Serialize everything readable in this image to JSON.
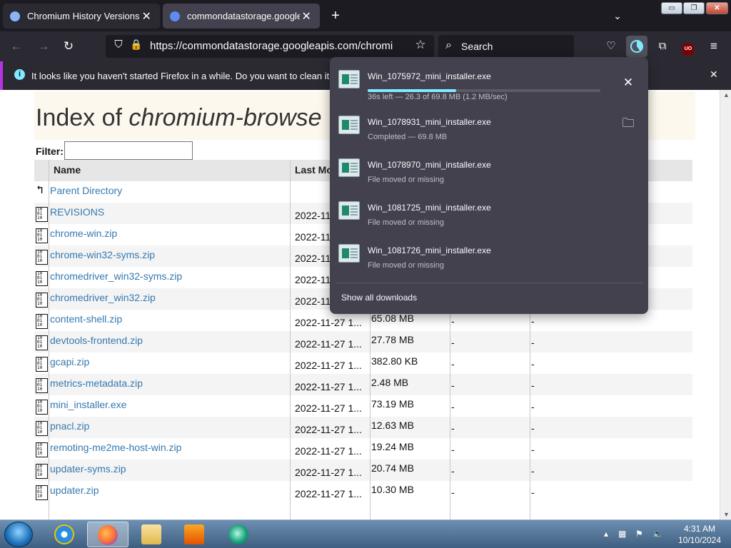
{
  "tabs": [
    {
      "title": "Chromium History Versions Do",
      "close": "✕"
    },
    {
      "title": "commondatastorage.googleapis",
      "close": "✕"
    }
  ],
  "new_tab": "+",
  "tab_list": "⌄",
  "window_controls": {
    "minimize": "▭",
    "maximize": "❐",
    "close": "✕"
  },
  "nav": {
    "back": "←",
    "forward": "→",
    "reload": "↻"
  },
  "url_bar": {
    "url": "https://commondatastorage.googleapis.com/chromium-bro"
  },
  "search_bar": {
    "placeholder": "Search"
  },
  "notification": {
    "message": "It looks like you haven't started Firefox in a while. Do you want to clean it up for",
    "close": "✕"
  },
  "page": {
    "title_prefix": "Index of ",
    "title_italic": "chromium-browse",
    "filter_label": "Filter:",
    "columns": [
      "Name",
      "Last Mo"
    ],
    "parent_directory": "Parent Directory",
    "rows": [
      {
        "name": "REVISIONS",
        "date": "2022-11",
        "size": "",
        "c1": "",
        "c2": ""
      },
      {
        "name": "chrome-win.zip",
        "date": "2022-11",
        "size": "",
        "c1": "",
        "c2": ""
      },
      {
        "name": "chrome-win32-syms.zip",
        "date": "2022-11",
        "size": "",
        "c1": "",
        "c2": ""
      },
      {
        "name": "chromedriver_win32-syms.zip",
        "date": "2022-11",
        "size": "",
        "c1": "",
        "c2": ""
      },
      {
        "name": "chromedriver_win32.zip",
        "date": "2022-11",
        "size": "",
        "c1": "",
        "c2": ""
      },
      {
        "name": "content-shell.zip",
        "date": "2022-11-27 1...",
        "size": "65.08 MB",
        "c1": "-",
        "c2": "-"
      },
      {
        "name": "devtools-frontend.zip",
        "date": "2022-11-27 1...",
        "size": "27.78 MB",
        "c1": "-",
        "c2": "-"
      },
      {
        "name": "gcapi.zip",
        "date": "2022-11-27 1...",
        "size": "382.80 KB",
        "c1": "-",
        "c2": "-"
      },
      {
        "name": "metrics-metadata.zip",
        "date": "2022-11-27 1...",
        "size": "2.48 MB",
        "c1": "-",
        "c2": "-"
      },
      {
        "name": "mini_installer.exe",
        "date": "2022-11-27 1...",
        "size": "73.19 MB",
        "c1": "-",
        "c2": "-"
      },
      {
        "name": "pnacl.zip",
        "date": "2022-11-27 1...",
        "size": "12.63 MB",
        "c1": "-",
        "c2": "-"
      },
      {
        "name": "remoting-me2me-host-win.zip",
        "date": "2022-11-27 1...",
        "size": "19.24 MB",
        "c1": "-",
        "c2": "-"
      },
      {
        "name": "updater-syms.zip",
        "date": "2022-11-27 1...",
        "size": "20.74 MB",
        "c1": "-",
        "c2": "-"
      },
      {
        "name": "updater.zip",
        "date": "2022-11-27 1...",
        "size": "10.30 MB",
        "c1": "-",
        "c2": "-"
      }
    ],
    "file_icon_text": "10 01 10"
  },
  "downloads": {
    "items": [
      {
        "name": "Win_1075972_mini_installer.exe",
        "status": "36s left — 26.3 of 69.8 MB (1.2 MB/sec)",
        "progress": 0.38,
        "action": "✕",
        "in_progress": true
      },
      {
        "name": "Win_1078931_mini_installer.exe",
        "status": "Completed — 69.8 MB",
        "action": "🗀",
        "in_progress": false
      },
      {
        "name": "Win_1078970_mini_installer.exe",
        "status": "File moved or missing",
        "action": "",
        "in_progress": false
      },
      {
        "name": "Win_1081725_mini_installer.exe",
        "status": "File moved or missing",
        "action": "",
        "in_progress": false
      },
      {
        "name": "Win_1081726_mini_installer.exe",
        "status": "File moved or missing",
        "action": "",
        "in_progress": false
      }
    ],
    "show_all": "Show all downloads"
  },
  "taskbar": {
    "clock_time": "4:31 AM",
    "clock_date": "10/10/2024"
  },
  "colors": {
    "accent": "#80ebff",
    "link": "#3579b0",
    "panel": "#42414d"
  }
}
